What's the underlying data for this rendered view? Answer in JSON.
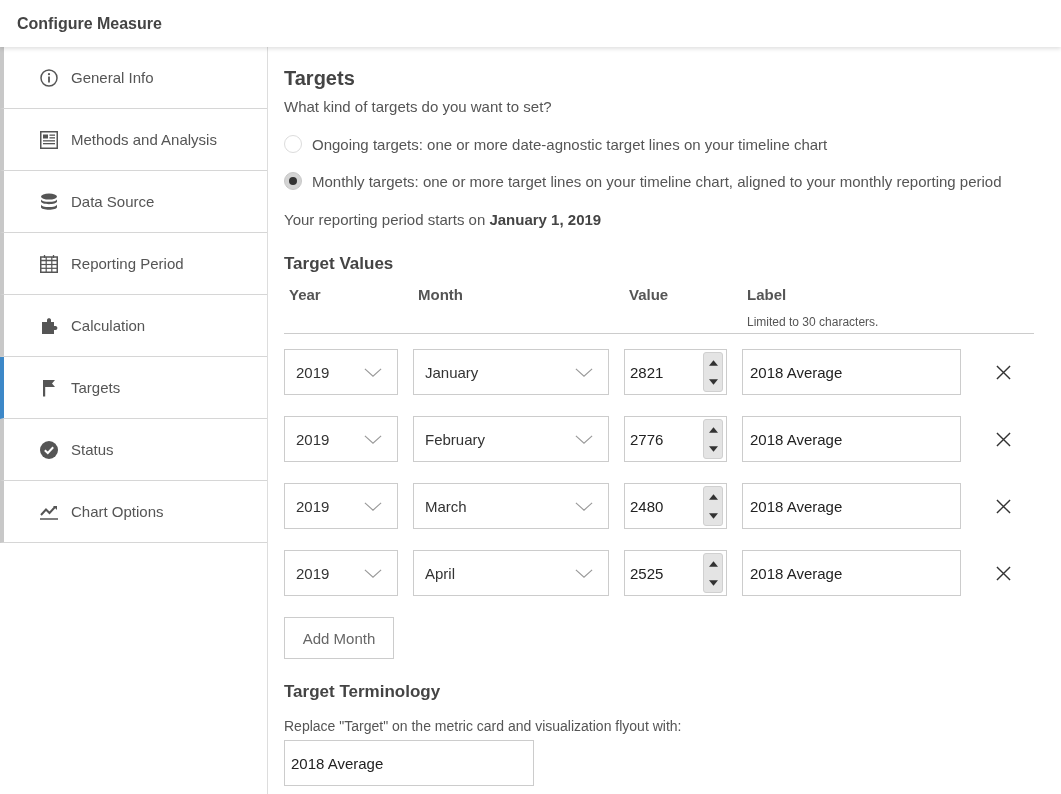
{
  "header": {
    "title": "Configure Measure"
  },
  "sidebar": {
    "items": [
      {
        "label": "General Info",
        "selected": false
      },
      {
        "label": "Methods and Analysis",
        "selected": false
      },
      {
        "label": "Data Source",
        "selected": false
      },
      {
        "label": "Reporting Period",
        "selected": false
      },
      {
        "label": "Calculation",
        "selected": false
      },
      {
        "label": "Targets",
        "selected": true
      },
      {
        "label": "Status",
        "selected": false
      },
      {
        "label": "Chart Options",
        "selected": false
      }
    ]
  },
  "targets": {
    "title": "Targets",
    "question": "What kind of targets do you want to set?",
    "options": [
      {
        "label": "Ongoing targets: one or more date-agnostic target lines on your timeline chart",
        "selected": false
      },
      {
        "label": "Monthly targets: one or more target lines on your timeline chart, aligned to your monthly reporting period",
        "selected": true
      }
    ],
    "reporting_period": "Your reporting period starts on **January 1, 2019**"
  },
  "target_values": {
    "title": "Target Values",
    "columns": [
      {
        "label": "Year"
      },
      {
        "label": "Month"
      },
      {
        "label": "Value"
      },
      {
        "label": "Label",
        "hint": "Limited to 30 characters."
      }
    ],
    "rows": [
      {
        "year": "2019",
        "month": "January",
        "value": "2821",
        "label": "2018 Average"
      },
      {
        "year": "2019",
        "month": "February",
        "value": "2776",
        "label": "2018 Average"
      },
      {
        "year": "2019",
        "month": "March",
        "value": "2480",
        "label": "2018 Average"
      },
      {
        "year": "2019",
        "month": "April",
        "value": "2525",
        "label": "2018 Average"
      }
    ],
    "add_button": "Add Month"
  },
  "target_terminology": {
    "title": "Target Terminology",
    "prompt": "Replace \"Target\" on the metric card and visualization flyout with:",
    "value": "2018 Average"
  }
}
